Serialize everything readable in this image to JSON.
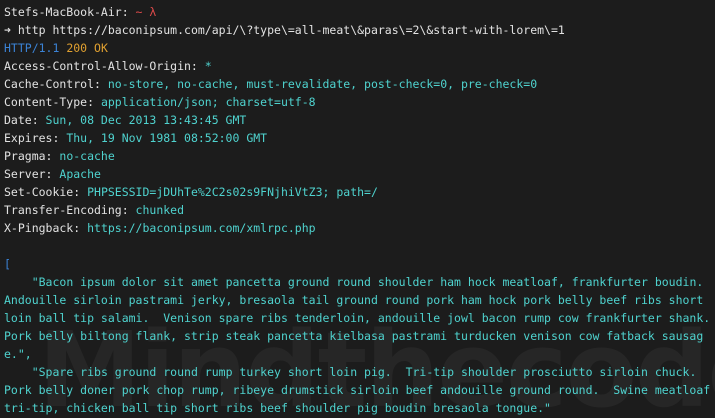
{
  "prompt": {
    "host": "Stefs-MacBook-Air:",
    "path": " ~",
    "symbol": " λ"
  },
  "command": {
    "arrow": "➜",
    "text": " http https://baconipsum.com/api/\\?type\\=all-meat\\&paras\\=2\\&start-with-lorem\\=1"
  },
  "status": {
    "protocol": "HTTP",
    "version": "/1.1",
    "code": " 200",
    "reason": " OK"
  },
  "headers": [
    {
      "name": "Access-Control-Allow-Origin:",
      "value": " *"
    },
    {
      "name": "Cache-Control:",
      "value": " no-store, no-cache, must-revalidate, post-check=0, pre-check=0"
    },
    {
      "name": "Content-Type:",
      "value": " application/json; charset=utf-8"
    },
    {
      "name": "Date:",
      "value": " Sun, 08 Dec 2013 13:43:45 GMT"
    },
    {
      "name": "Expires:",
      "value": " Thu, 19 Nov 1981 08:52:00 GMT"
    },
    {
      "name": "Pragma:",
      "value": " no-cache"
    },
    {
      "name": "Server:",
      "value": " Apache"
    },
    {
      "name": "Set-Cookie:",
      "value": " PHPSESSID=jDUhTe%2C2s02s9FNjhiVtZ3; path=/"
    },
    {
      "name": "Transfer-Encoding:",
      "value": " chunked"
    },
    {
      "name": "X-Pingback:",
      "value": " https://baconipsum.com/xmlrpc.php"
    }
  ],
  "body": {
    "open_bracket": "[",
    "paragraph_1": "    \"Bacon ipsum dolor sit amet pancetta ground round shoulder ham hock meatloaf, frankfurter boudin.  Andouille sirloin pastrami jerky, bresaola tail ground round pork ham hock pork belly beef ribs short loin ball tip salami.  Venison spare ribs tenderloin, andouille jowl bacon rump cow frankfurter shank.  Pork belly biltong flank, strip steak pancetta kielbasa pastrami turducken venison cow fatback sausage.\",",
    "paragraph_2": "    \"Spare ribs ground round rump turkey short loin pig.  Tri-tip shoulder prosciutto sirloin chuck.  Pork belly doner pork chop rump, ribeye drumstick sirloin beef andouille ground round.  Swine meatloaf tri-tip, chicken ball tip short ribs beef shoulder pig boudin bresaola tongue.\"",
    "close_bracket": "]"
  },
  "watermark": "Mindthecode",
  "colors": {
    "background": "#1c1c1c",
    "header_value": "#4fd3cf",
    "http_blue": "#3b83d6",
    "ok_orange": "#e0a030",
    "prompt_path_red": "#e04a4a"
  }
}
